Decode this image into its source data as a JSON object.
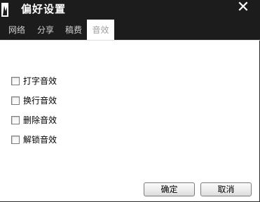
{
  "window": {
    "title": "偏好设置",
    "close_glyph": "✕"
  },
  "tabs": [
    {
      "label": "网络",
      "active": false
    },
    {
      "label": "分享",
      "active": false
    },
    {
      "label": "稿费",
      "active": false
    },
    {
      "label": "音效",
      "active": true
    }
  ],
  "options": [
    {
      "label": "打字音效",
      "checked": false
    },
    {
      "label": "换行音效",
      "checked": false
    },
    {
      "label": "删除音效",
      "checked": false
    },
    {
      "label": "解锁音效",
      "checked": false
    }
  ],
  "buttons": {
    "ok_label": "确定",
    "cancel_label": "取消"
  },
  "icons": {
    "app": "app-logo-icon",
    "close": "close-icon"
  },
  "colors": {
    "titlebar_bg": "#1c1c1c",
    "active_tab_bg": "#ffffff",
    "active_tab_text": "#a0a0a0",
    "inactive_tab_text": "#cfcfcf"
  }
}
